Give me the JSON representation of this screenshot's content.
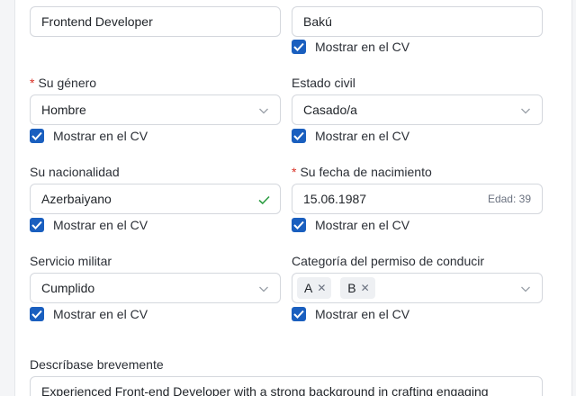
{
  "top_row": {
    "position_value": "Frontend Developer",
    "city_value": "Bakú",
    "city_show_cv": "Mostrar en el CV"
  },
  "gender": {
    "label": "Su género",
    "required_mark": "*",
    "value": "Hombre",
    "show_cv": "Mostrar en el CV"
  },
  "marital": {
    "label": "Estado civil",
    "value": "Casado/a",
    "show_cv": "Mostrar en el CV"
  },
  "nationality": {
    "label": "Su nacionalidad",
    "value": "Azerbaiyano",
    "show_cv": "Mostrar en el CV"
  },
  "birthdate": {
    "label": "Su fecha de nacimiento",
    "required_mark": "*",
    "value": "15.06.1987",
    "age": "Edad: 39",
    "show_cv": "Mostrar en el CV"
  },
  "military": {
    "label": "Servicio militar",
    "value": "Cumplido",
    "show_cv": "Mostrar en el CV"
  },
  "license": {
    "label": "Categoría del permiso de conducir",
    "tags": [
      "A",
      "B"
    ],
    "show_cv": "Mostrar en el CV"
  },
  "about": {
    "label": "Descríbase brevemente",
    "value": "Experienced Front-end Developer with a strong background in crafting engaging"
  },
  "colors": {
    "accent": "#1a5fbf",
    "required": "#d93025",
    "valid": "#2e9e44"
  },
  "icons": [
    "chevron-down-icon",
    "checkmark-icon",
    "close-icon"
  ]
}
